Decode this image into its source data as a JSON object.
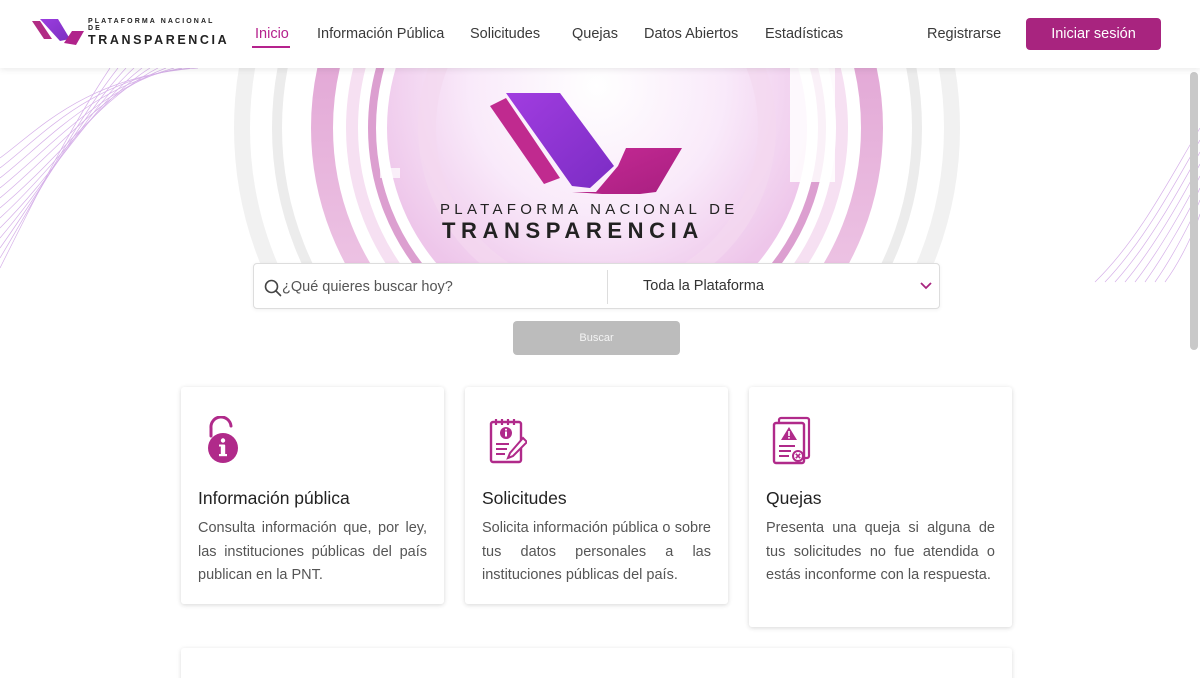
{
  "header": {
    "logo": {
      "line1": "PLATAFORMA NACIONAL DE",
      "line2": "TRANSPARENCIA",
      "icon": "pnt-logo-icon"
    },
    "nav": [
      {
        "label": "Inicio",
        "active": true
      },
      {
        "label": "Información Pública",
        "active": false
      },
      {
        "label": "Solicitudes",
        "active": false
      },
      {
        "label": "Quejas",
        "active": false
      },
      {
        "label": "Datos Abiertos",
        "active": false
      },
      {
        "label": "Estadísticas",
        "active": false
      }
    ],
    "register_label": "Registrarse",
    "login_label": "Iniciar sesión"
  },
  "hero": {
    "title_line1": "PLATAFORMA NACIONAL DE",
    "title_line2": "TRANSPARENCIA"
  },
  "search": {
    "placeholder": "¿Qué quieres buscar hoy?",
    "scope_selected": "Toda la Plataforma",
    "button_label": "Buscar"
  },
  "cards": [
    {
      "icon": "unlocked-info-icon",
      "title": "Información pública",
      "description": "Consulta información que, por ley, las instituciones públicas del país publican en la PNT."
    },
    {
      "icon": "request-document-icon",
      "title": "Solicitudes",
      "description": "Solicita información pública o sobre tus datos personales a las instituciones públicas del país."
    },
    {
      "icon": "complaint-document-icon",
      "title": "Quejas",
      "description": "Presenta una queja si alguna de tus solicitudes no fue atendida o estás inconforme con la respuesta."
    }
  ],
  "colors": {
    "brand_magenta": "#a8247f",
    "brand_purple": "#8e3bd6",
    "active_nav": "#b5228d",
    "button_disabled": "#bcbcbc"
  }
}
